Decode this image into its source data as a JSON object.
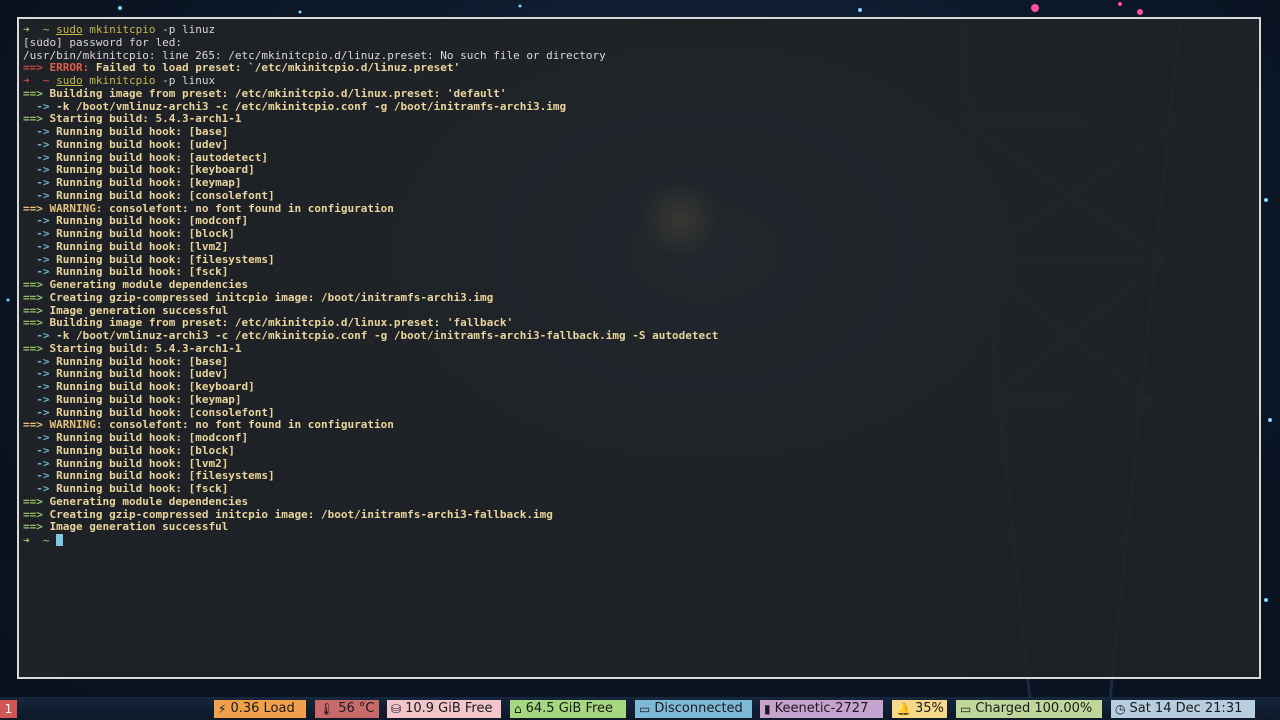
{
  "terminal": {
    "lines": [
      [
        {
          "t": "➜  ~ ",
          "c": "pr"
        },
        {
          "t": "sudo",
          "c": "cmdu"
        },
        {
          "t": " mkinitcpio ",
          "c": "cmd"
        },
        {
          "t": "-p linuz",
          "c": "pl"
        }
      ],
      [
        {
          "t": "[sudo] password for led:",
          "c": "pl"
        }
      ],
      [
        {
          "t": "/usr/bin/mkinitcpio: line 265: /etc/mkinitcpio.d/linuz.preset: No such file or directory",
          "c": "pl"
        }
      ],
      [
        {
          "t": "==> ",
          "c": "rb"
        },
        {
          "t": "ERROR: ",
          "c": "r"
        },
        {
          "t": "Failed to load preset: `/etc/mkinitcpio.d/linuz.preset'",
          "c": "y"
        }
      ],
      [
        {
          "t": "➜  ~ ",
          "c": "rb"
        },
        {
          "t": "sudo",
          "c": "cmdu"
        },
        {
          "t": " mkinitcpio ",
          "c": "cmd"
        },
        {
          "t": "-p linux",
          "c": "pl"
        }
      ],
      [
        {
          "t": "==> ",
          "c": "g"
        },
        {
          "t": "Building image from preset: /etc/mkinitcpio.d/linux.preset: 'default'",
          "c": "y"
        }
      ],
      [
        {
          "t": "  -> ",
          "c": "c"
        },
        {
          "t": "-k /boot/vmlinuz-archi3 -c /etc/mkinitcpio.conf -g /boot/initramfs-archi3.img",
          "c": "y"
        }
      ],
      [
        {
          "t": "==> ",
          "c": "g"
        },
        {
          "t": "Starting build: 5.4.3-arch1-1",
          "c": "y"
        }
      ],
      [
        {
          "t": "  -> ",
          "c": "c"
        },
        {
          "t": "Running build hook: [base]",
          "c": "y"
        }
      ],
      [
        {
          "t": "  -> ",
          "c": "c"
        },
        {
          "t": "Running build hook: [udev]",
          "c": "y"
        }
      ],
      [
        {
          "t": "  -> ",
          "c": "c"
        },
        {
          "t": "Running build hook: [autodetect]",
          "c": "y"
        }
      ],
      [
        {
          "t": "  -> ",
          "c": "c"
        },
        {
          "t": "Running build hook: [keyboard]",
          "c": "y"
        }
      ],
      [
        {
          "t": "  -> ",
          "c": "c"
        },
        {
          "t": "Running build hook: [keymap]",
          "c": "y"
        }
      ],
      [
        {
          "t": "  -> ",
          "c": "c"
        },
        {
          "t": "Running build hook: [consolefont]",
          "c": "y"
        }
      ],
      [
        {
          "t": "==> ",
          "c": "yb"
        },
        {
          "t": "WARNING: ",
          "c": "yb"
        },
        {
          "t": "consolefont: no font found in configuration",
          "c": "y"
        }
      ],
      [
        {
          "t": "  -> ",
          "c": "c"
        },
        {
          "t": "Running build hook: [modconf]",
          "c": "y"
        }
      ],
      [
        {
          "t": "  -> ",
          "c": "c"
        },
        {
          "t": "Running build hook: [block]",
          "c": "y"
        }
      ],
      [
        {
          "t": "  -> ",
          "c": "c"
        },
        {
          "t": "Running build hook: [lvm2]",
          "c": "y"
        }
      ],
      [
        {
          "t": "  -> ",
          "c": "c"
        },
        {
          "t": "Running build hook: [filesystems]",
          "c": "y"
        }
      ],
      [
        {
          "t": "  -> ",
          "c": "c"
        },
        {
          "t": "Running build hook: [fsck]",
          "c": "y"
        }
      ],
      [
        {
          "t": "==> ",
          "c": "g"
        },
        {
          "t": "Generating module dependencies",
          "c": "y"
        }
      ],
      [
        {
          "t": "==> ",
          "c": "g"
        },
        {
          "t": "Creating gzip-compressed initcpio image: /boot/initramfs-archi3.img",
          "c": "y"
        }
      ],
      [
        {
          "t": "==> ",
          "c": "g"
        },
        {
          "t": "Image generation successful",
          "c": "y"
        }
      ],
      [
        {
          "t": "==> ",
          "c": "g"
        },
        {
          "t": "Building image from preset: /etc/mkinitcpio.d/linux.preset: 'fallback'",
          "c": "y"
        }
      ],
      [
        {
          "t": "  -> ",
          "c": "c"
        },
        {
          "t": "-k /boot/vmlinuz-archi3 -c /etc/mkinitcpio.conf -g /boot/initramfs-archi3-fallback.img -S autodetect",
          "c": "y"
        }
      ],
      [
        {
          "t": "==> ",
          "c": "g"
        },
        {
          "t": "Starting build: 5.4.3-arch1-1",
          "c": "y"
        }
      ],
      [
        {
          "t": "  -> ",
          "c": "c"
        },
        {
          "t": "Running build hook: [base]",
          "c": "y"
        }
      ],
      [
        {
          "t": "  -> ",
          "c": "c"
        },
        {
          "t": "Running build hook: [udev]",
          "c": "y"
        }
      ],
      [
        {
          "t": "  -> ",
          "c": "c"
        },
        {
          "t": "Running build hook: [keyboard]",
          "c": "y"
        }
      ],
      [
        {
          "t": "  -> ",
          "c": "c"
        },
        {
          "t": "Running build hook: [keymap]",
          "c": "y"
        }
      ],
      [
        {
          "t": "  -> ",
          "c": "c"
        },
        {
          "t": "Running build hook: [consolefont]",
          "c": "y"
        }
      ],
      [
        {
          "t": "==> ",
          "c": "yb"
        },
        {
          "t": "WARNING: ",
          "c": "yb"
        },
        {
          "t": "consolefont: no font found in configuration",
          "c": "y"
        }
      ],
      [
        {
          "t": "  -> ",
          "c": "c"
        },
        {
          "t": "Running build hook: [modconf]",
          "c": "y"
        }
      ],
      [
        {
          "t": "  -> ",
          "c": "c"
        },
        {
          "t": "Running build hook: [block]",
          "c": "y"
        }
      ],
      [
        {
          "t": "  -> ",
          "c": "c"
        },
        {
          "t": "Running build hook: [lvm2]",
          "c": "y"
        }
      ],
      [
        {
          "t": "  -> ",
          "c": "c"
        },
        {
          "t": "Running build hook: [filesystems]",
          "c": "y"
        }
      ],
      [
        {
          "t": "  -> ",
          "c": "c"
        },
        {
          "t": "Running build hook: [fsck]",
          "c": "y"
        }
      ],
      [
        {
          "t": "==> ",
          "c": "g"
        },
        {
          "t": "Generating module dependencies",
          "c": "y"
        }
      ],
      [
        {
          "t": "==> ",
          "c": "g"
        },
        {
          "t": "Creating gzip-compressed initcpio image: /boot/initramfs-archi3-fallback.img",
          "c": "y"
        }
      ],
      [
        {
          "t": "==> ",
          "c": "g"
        },
        {
          "t": "Image generation successful",
          "c": "y"
        }
      ],
      [
        {
          "t": "➜  ~ ",
          "c": "pr"
        },
        {
          "t": "",
          "c": "cursor"
        }
      ]
    ]
  },
  "statusbar": {
    "workspace": "1",
    "modules": [
      {
        "name": "load-module",
        "icon": "⚡",
        "icon_name": "activity-icon",
        "text": "0.36 Load",
        "bg": "#f0a04b",
        "fg": "#1a1a1a"
      },
      {
        "name": "temperature-module",
        "icon": "🌡",
        "icon_name": "thermometer-icon",
        "text": "56 °C",
        "bg": "#c96a6a",
        "fg": "#1a1a1a"
      },
      {
        "name": "disk-module-1",
        "icon": "⛁",
        "icon_name": "hard-drive-icon",
        "text": "10.9 GiB Free",
        "bg": "#f3c6cb",
        "fg": "#1a1a1a"
      },
      {
        "name": "disk-module-2",
        "icon": "⌂",
        "icon_name": "home-icon",
        "text": "64.5 GiB Free",
        "bg": "#a6d87f",
        "fg": "#1a1a1a"
      },
      {
        "name": "network-module",
        "icon": "▭",
        "icon_name": "monitor-icon",
        "text": "Disconnected",
        "bg": "#7fb9d8",
        "fg": "#1a1a1a"
      },
      {
        "name": "wifi-module",
        "icon": "▮",
        "icon_name": "signal-icon",
        "text": "Keenetic-2727",
        "bg": "#c6a2cf",
        "fg": "#1a1a1a"
      },
      {
        "name": "volume-module",
        "icon": "🔔",
        "icon_name": "bell-icon",
        "text": "35%",
        "bg": "#f6d88b",
        "fg": "#1a1a1a"
      },
      {
        "name": "battery-module",
        "icon": "▭",
        "icon_name": "battery-icon",
        "text": "Charged 100.00%",
        "bg": "#bfd79a",
        "fg": "#1a1a1a"
      },
      {
        "name": "clock-module",
        "icon": "◷",
        "icon_name": "clock-icon",
        "text": "Sat 14 Dec 21:31",
        "bg": "#b7cde0",
        "fg": "#1a1a1a"
      }
    ]
  }
}
